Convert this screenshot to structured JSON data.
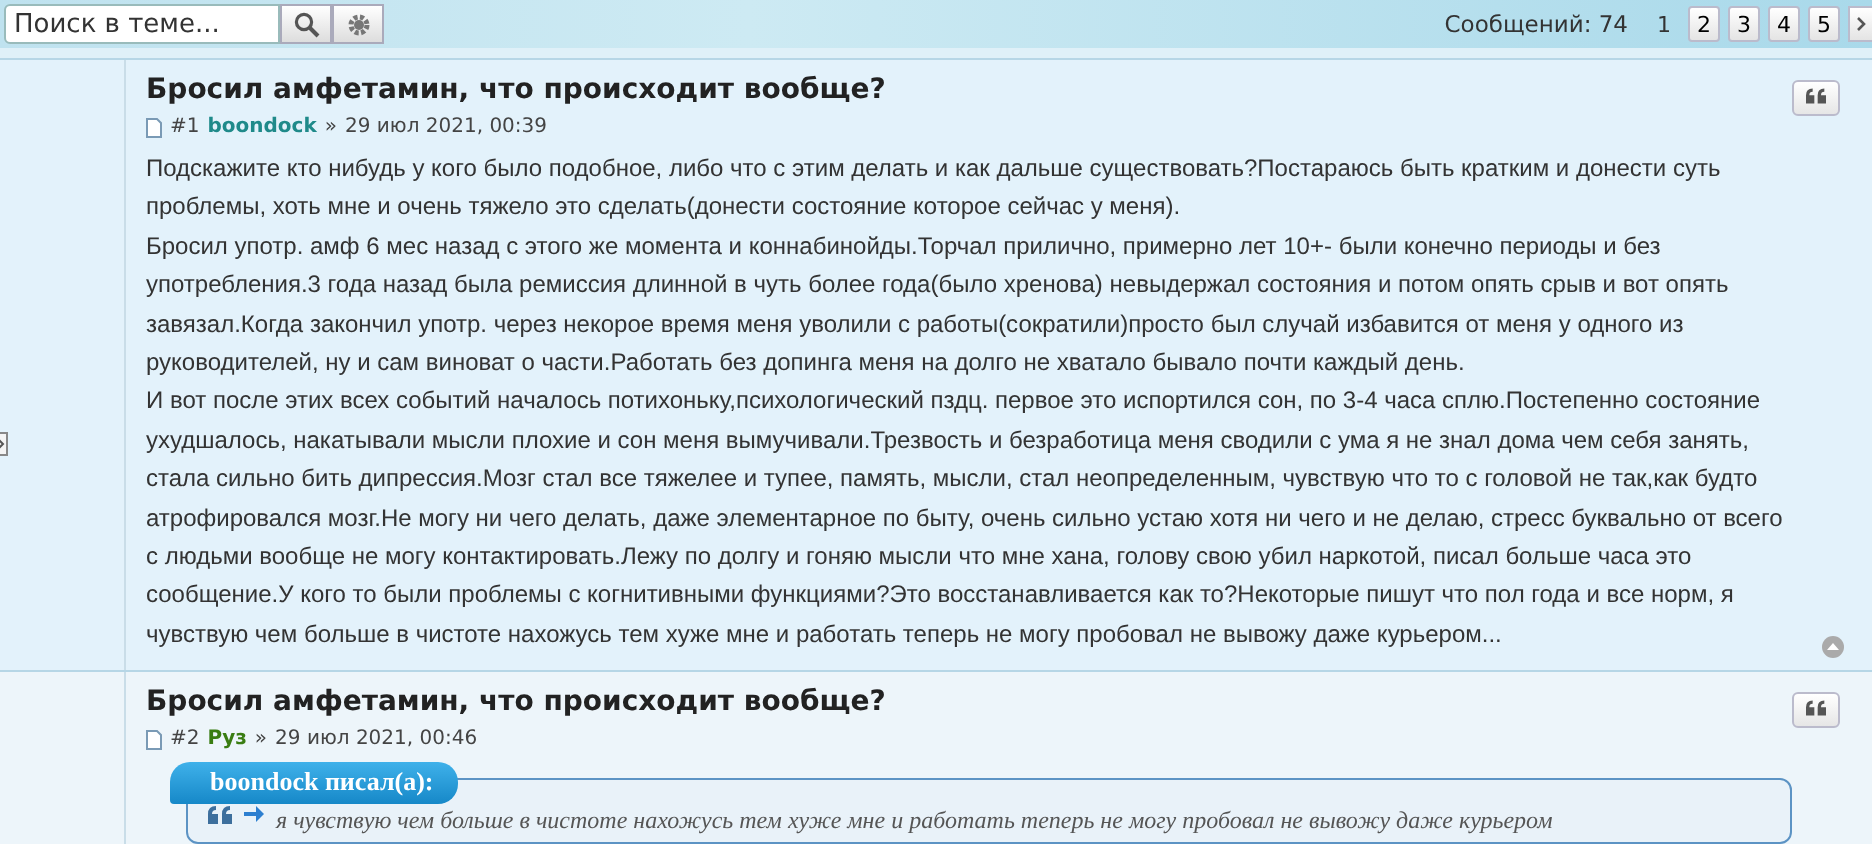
{
  "search": {
    "placeholder": "Поиск в теме..."
  },
  "pagination": {
    "label": "Сообщений: 74",
    "pages": [
      {
        "label": "1",
        "selected": true
      },
      {
        "label": "2",
        "selected": false
      },
      {
        "label": "3",
        "selected": false
      },
      {
        "label": "4",
        "selected": false
      },
      {
        "label": "5",
        "selected": false
      }
    ]
  },
  "posts": [
    {
      "title": "Бросил амфетамин, что происходит вообще?",
      "number": "#1",
      "author": "boondock",
      "color": "#1f8a8a",
      "separator": "»",
      "date": "29 июл 2021, 00:39",
      "paragraphs": [
        "Подскажите кто нибудь у кого было подобное, либо что с этим делать и как дальше существовать?Постараюсь быть кратким и донести суть проблемы, хоть мне и очень тяжело это сделать(донести состояние которое сейчас у меня).",
        "Бросил употр. амф 6 мес назад с этого же момента и коннабинойды.Торчал прилично, примерно лет 10+- были конечно периоды и без употребления.3 года назад была ремиссия длинной в чуть более года(было хренова) невыдержал состояния и потом опять срыв и вот опять завязал.Когда закончил употр. через некорое время меня уволили с работы(сократили)просто был случай избавится от меня у одного из руководителей, ну и сам виноват о части.Работать без допинга меня на долго не хватало бывало почти каждый день.",
        "И вот после этих всех событий началось потихоньку,психологический пздц. первое это испортился сон, по 3-4 часа сплю.Постепенно состояние ухудшалось, накатывали мысли плохие и сон меня вымучивали.Трезвость и безработица меня сводили с ума я не знал дома чем себя занять, стала сильно бить дипрессия.Мозг стал все тяжелее и тупее, память, мысли, стал неопределенным, чувствую что то с головой не так,как будто атрофировался мозг.Не могу ни чего делать, даже элементарное по быту, очень сильно устаю хотя ни чего и не делаю, стресс буквально от всего с людьми вообще не могу контактировать.Лежу по долгу и гоняю мысли что мне хана, голову свою убил наркотой, писал больше часа это сообщение.У кого то были проблемы с когнитивными функциями?Это восстанавливается как то?Некоторые пишут что пол года и все норм, я чувствую чем больше в чистоте нахожусь тем хуже мне и работать теперь не могу пробовал не вывожу даже курьером..."
      ]
    },
    {
      "title": "Бросил амфетамин, что происходит вообще?",
      "number": "#2",
      "author": "Руз",
      "color": "#3a7d12",
      "separator": "»",
      "date": "29 июл 2021, 00:46",
      "quote": {
        "label": "boondock писал(а):",
        "text": "я чувствую чем больше в чистоте нахожусь тем хуже мне и работать теперь не могу пробовал не вывожу даже курьером"
      }
    }
  ]
}
